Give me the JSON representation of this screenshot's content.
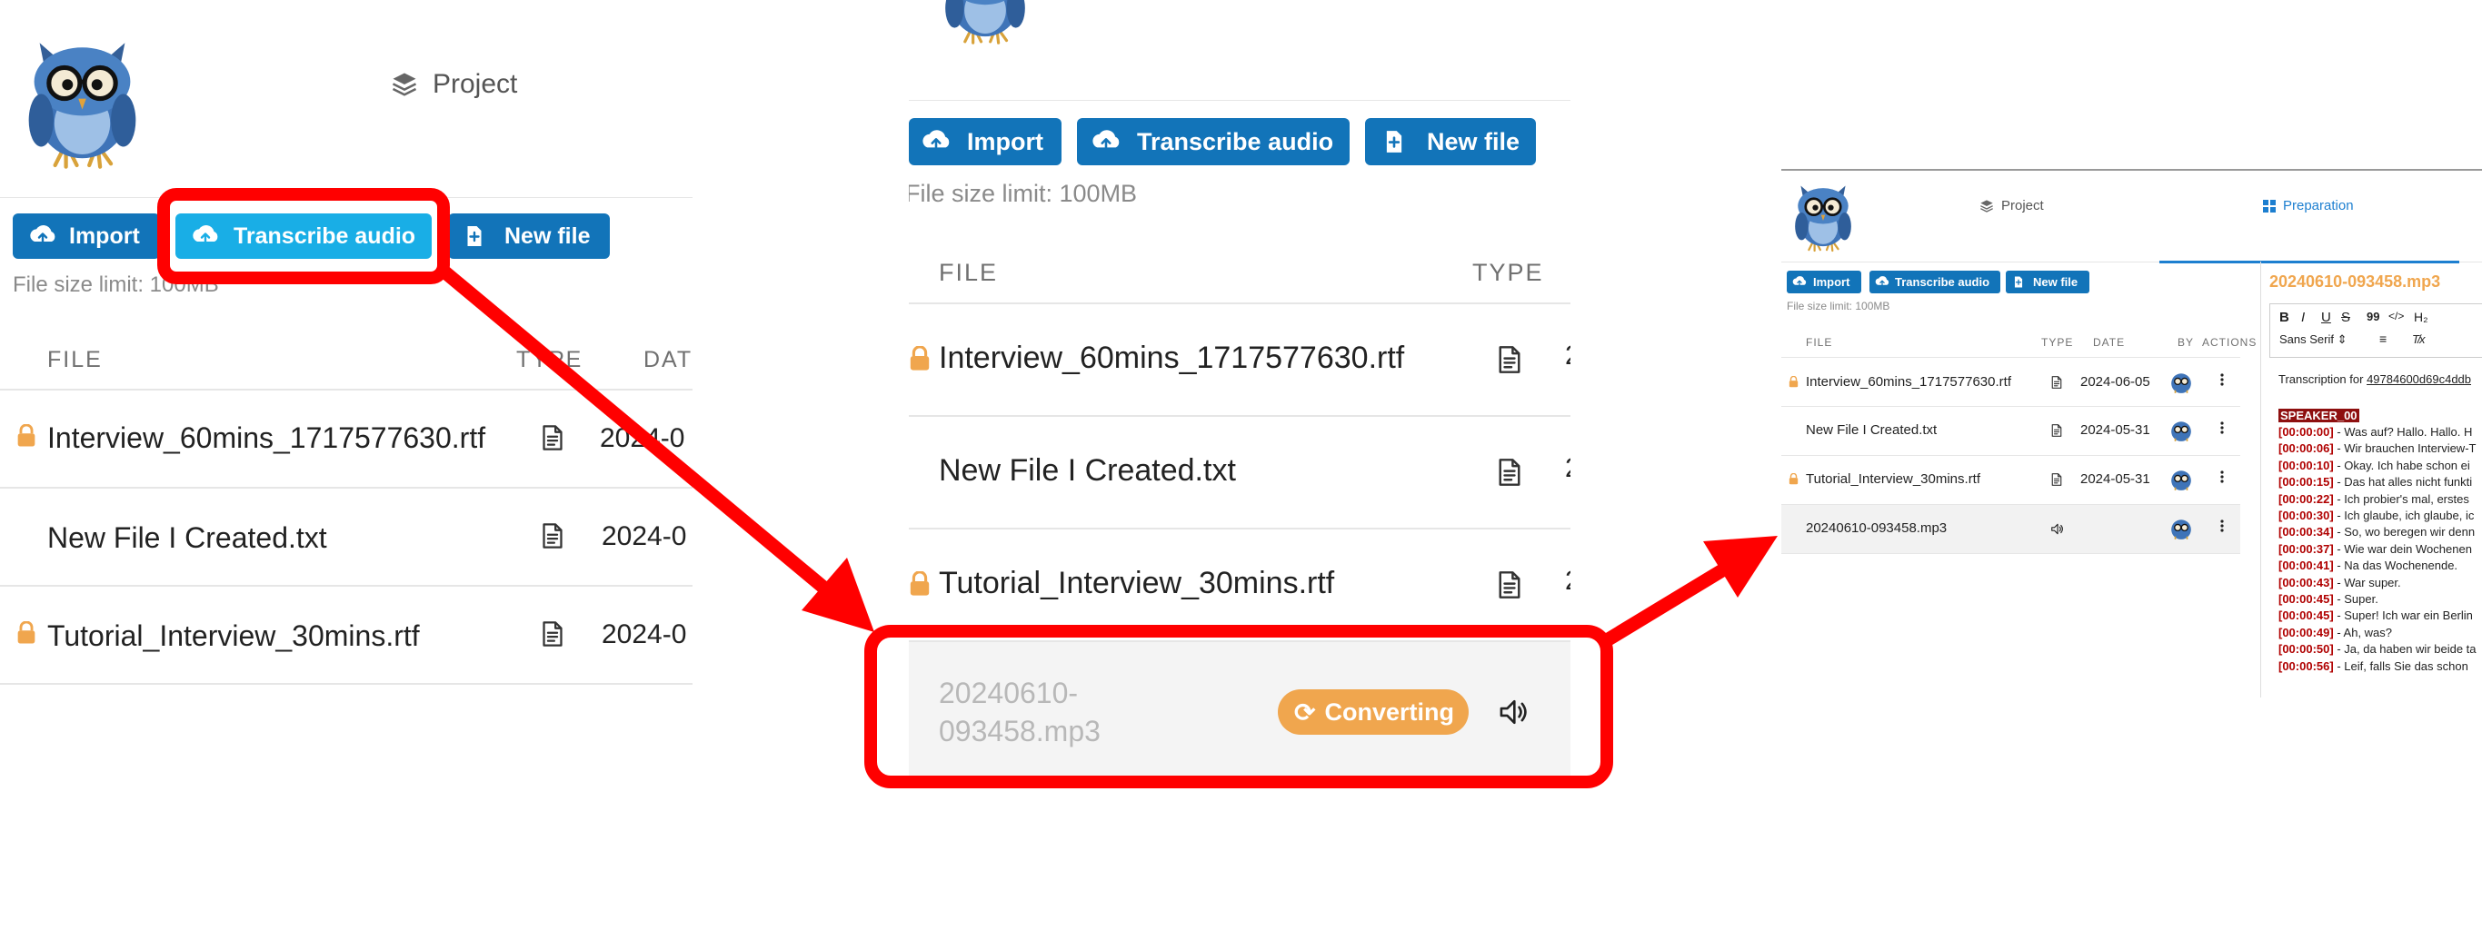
{
  "colors": {
    "primary_button": "#1274b9",
    "active_button": "#19aee6",
    "highlight_red": "#ff0000",
    "lock_orange": "#f0a64e",
    "converting_badge": "#f0a64e",
    "preparation_blue": "#1d7fd0"
  },
  "icons": {
    "logo": "owl-with-glasses",
    "project": "layers-icon",
    "import": "cloud-upload-icon",
    "transcribe": "cloud-upload-icon",
    "new_file": "file-plus-icon",
    "lock": "lock-icon",
    "document": "document-icon",
    "audio": "speaker-icon",
    "converting": "refresh-icon",
    "more": "vertical-dots-icon"
  },
  "panel1": {
    "project_tab": "Project",
    "buttons": {
      "import": "Import",
      "transcribe": "Transcribe audio",
      "new_file": "New file"
    },
    "size_limit": "File size limit: 100MB",
    "headers": {
      "file": "FILE",
      "type": "TYPE",
      "date": "DAT"
    },
    "rows": [
      {
        "name": "Interview_60mins_1717577630.rtf",
        "date": "2024-0"
      },
      {
        "name": "New File I Created.txt",
        "date": "2024-0"
      },
      {
        "name": "Tutorial_Interview_30mins.rtf",
        "date": "2024-0"
      }
    ]
  },
  "panel2": {
    "buttons": {
      "import": "Import",
      "transcribe": "Transcribe audio",
      "new_file": "New file"
    },
    "size_limit": "File size limit: 100MB",
    "headers": {
      "file": "FILE",
      "type": "TYPE"
    },
    "rows": [
      {
        "name": "Interview_60mins_1717577630.rtf",
        "date_fragment": "2"
      },
      {
        "name": "New File I Created.txt",
        "date_fragment": "2"
      },
      {
        "name": "Tutorial_Interview_30mins.rtf",
        "date_fragment": "2"
      }
    ],
    "converting_file": {
      "line1": "20240610-",
      "line2": "093458.mp3",
      "status": "Converting"
    }
  },
  "panel3": {
    "tabs": {
      "project": "Project",
      "preparation": "Preparation"
    },
    "buttons": {
      "import": "Import",
      "transcribe": "Transcribe audio",
      "new_file": "New file"
    },
    "size_limit": "File size limit: 100MB",
    "headers": {
      "file": "FILE",
      "type": "TYPE",
      "date": "DATE",
      "by": "BY",
      "actions": "ACTIONS"
    },
    "rows": [
      {
        "name": "Interview_60mins_1717577630.rtf",
        "date": "2024-06-05"
      },
      {
        "name": "New File I Created.txt",
        "date": "2024-05-31"
      },
      {
        "name": "Tutorial_Interview_30mins.rtf",
        "date": "2024-05-31"
      },
      {
        "name": "20240610-093458.mp3",
        "date": ""
      }
    ],
    "editor": {
      "filename": "20240610-093458.mp3",
      "font_select": "Sans Serif",
      "toolbar": {
        "bold": "B",
        "italic": "I",
        "underline": "U",
        "strike": "S",
        "quote": "99",
        "code": "</>",
        "heading": "H₂",
        "clear": "T̸x"
      },
      "transcription_prefix": "Transcription for ",
      "transcription_id": "49784600d69c4ddb",
      "speaker": "SPEAKER_00",
      "lines": [
        {
          "ts": "[00:00:00]",
          "text": " - Was auf? Hallo. Hallo. H"
        },
        {
          "ts": "[00:00:06]",
          "text": " - Wir brauchen Interview-T"
        },
        {
          "ts": "[00:00:10]",
          "text": " - Okay. Ich habe schon ei"
        },
        {
          "ts": "[00:00:15]",
          "text": " - Das hat alles nicht funkti"
        },
        {
          "ts": "[00:00:22]",
          "text": " - Ich probier's mal, erstes"
        },
        {
          "ts": "[00:00:30]",
          "text": " - Ich glaube, ich glaube, ic"
        },
        {
          "ts": "[00:00:34]",
          "text": " - So, wo beregen wir denn"
        },
        {
          "ts": "[00:00:37]",
          "text": " - Wie war dein Wochenen"
        },
        {
          "ts": "[00:00:41]",
          "text": " - Na das Wochenende."
        },
        {
          "ts": "[00:00:43]",
          "text": " - War super."
        },
        {
          "ts": "[00:00:45]",
          "text": " - Super."
        },
        {
          "ts": "[00:00:45]",
          "text": " - Super! Ich war ein Berlin"
        },
        {
          "ts": "[00:00:49]",
          "text": " - Ah, was?"
        },
        {
          "ts": "[00:00:50]",
          "text": " - Ja, da haben wir beide ta"
        },
        {
          "ts": "[00:00:56]",
          "text": " - Leif, falls Sie das schon"
        }
      ]
    }
  }
}
